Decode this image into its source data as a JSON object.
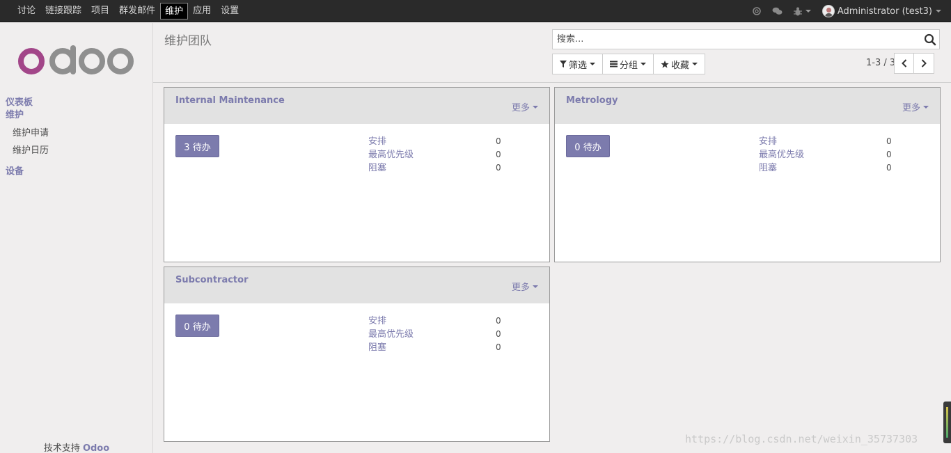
{
  "topnav": {
    "items": [
      {
        "label": "讨论"
      },
      {
        "label": "链接跟踪"
      },
      {
        "label": "项目"
      },
      {
        "label": "群发邮件"
      },
      {
        "label": "维护"
      },
      {
        "label": "应用"
      },
      {
        "label": "设置"
      }
    ],
    "active_index": 4,
    "user": "Administrator (test3)",
    "icons": [
      "at-icon",
      "chat-icon",
      "bug-icon"
    ]
  },
  "sidebar": {
    "sections": {
      "dashboard": "仪表板",
      "maintenance": "维护",
      "maintenance_request": "维护申请",
      "maintenance_calendar": "维护日历",
      "equipment": "设备"
    },
    "powered_prefix": "技术支持 ",
    "powered_brand": "Odoo"
  },
  "control": {
    "title": "维护团队",
    "search_placeholder": "搜索...",
    "filter_label": "筛选",
    "group_label": "分组",
    "favorite_label": "收藏",
    "pager": "1-3 / 3"
  },
  "cards": [
    {
      "name": "Internal Maintenance",
      "more": "更多",
      "todo": "3 待办",
      "stats": [
        {
          "label": "安排",
          "value": "0"
        },
        {
          "label": "最高优先级",
          "value": "0"
        },
        {
          "label": "阻塞",
          "value": "0"
        }
      ]
    },
    {
      "name": "Metrology",
      "more": "更多",
      "todo": "0 待办",
      "stats": [
        {
          "label": "安排",
          "value": "0"
        },
        {
          "label": "最高优先级",
          "value": "0"
        },
        {
          "label": "阻塞",
          "value": "0"
        }
      ]
    },
    {
      "name": "Subcontractor",
      "more": "更多",
      "todo": "0 待办",
      "stats": [
        {
          "label": "安排",
          "value": "0"
        },
        {
          "label": "最高优先级",
          "value": "0"
        },
        {
          "label": "阻塞",
          "value": "0"
        }
      ]
    }
  ],
  "watermark": "https://blog.csdn.net/weixin_35737303",
  "colors": {
    "brand": "#7c7bad",
    "navbar": "#2a2a2a",
    "logo_o": "#a24689",
    "logo_doo": "#8f8f8f"
  }
}
